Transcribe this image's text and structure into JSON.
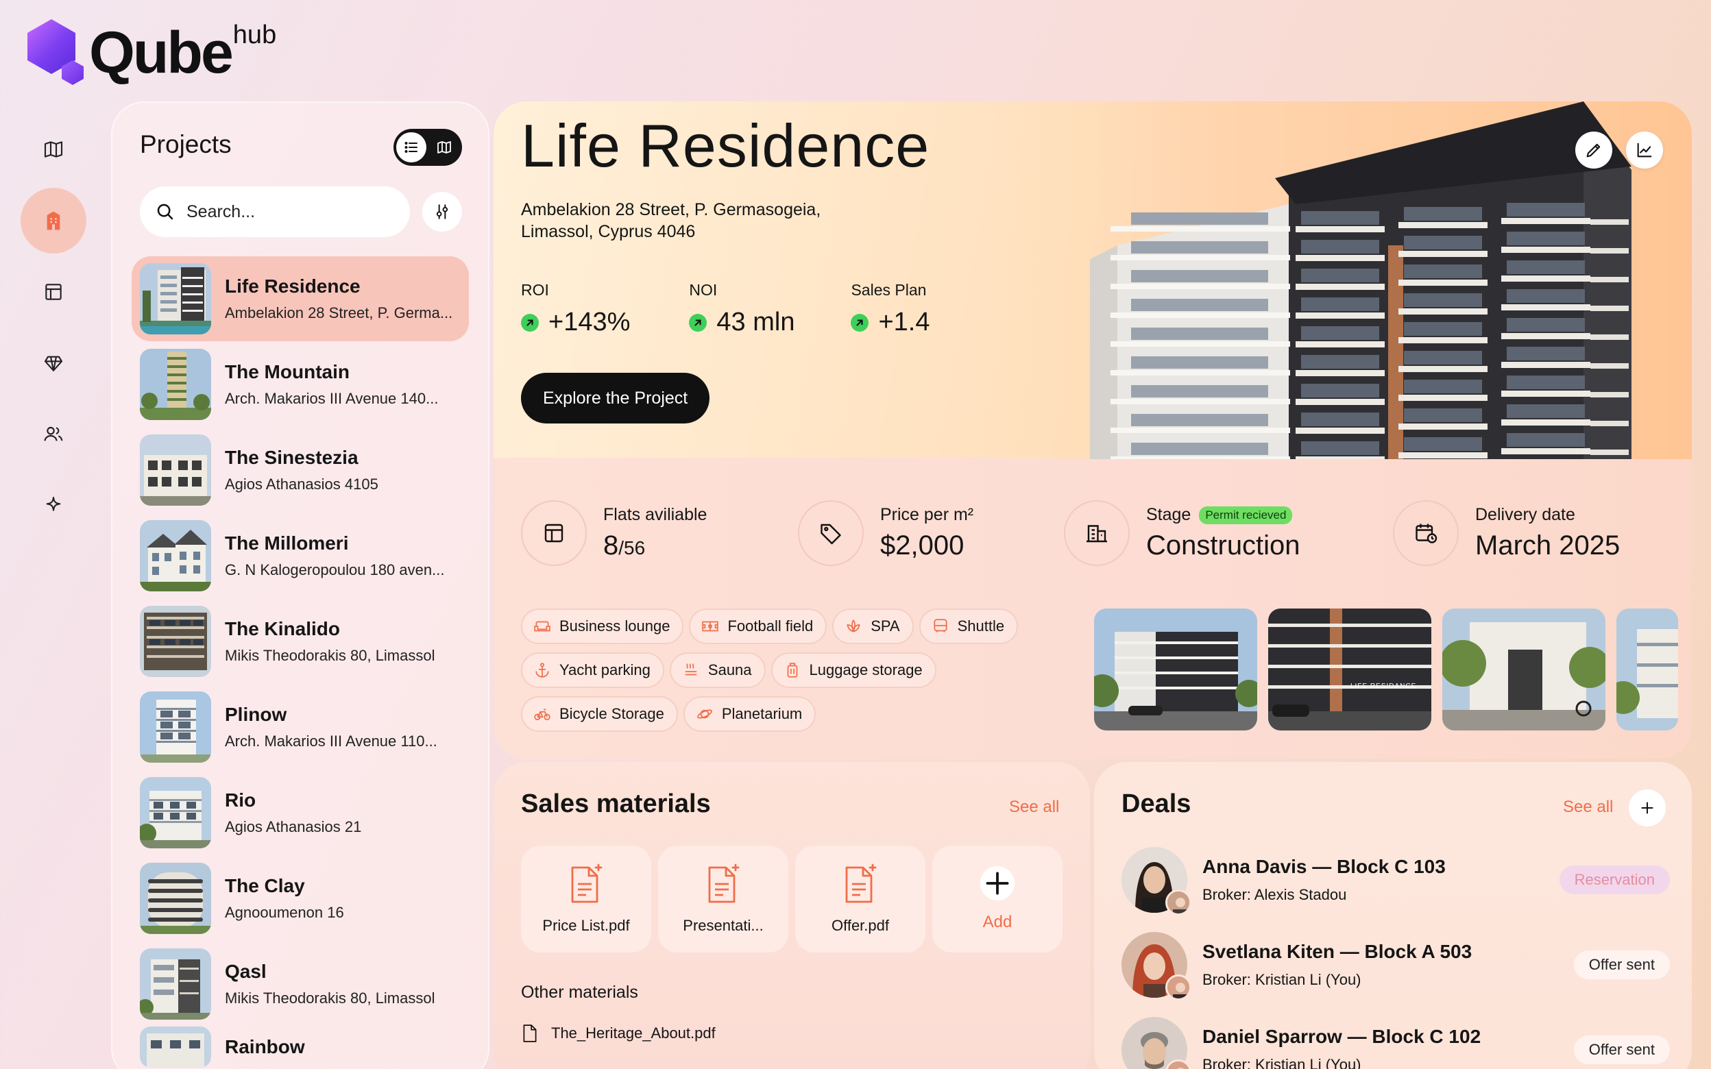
{
  "brand": {
    "name": "Qube",
    "sup": "hub"
  },
  "rail": [
    {
      "name": "map-icon"
    },
    {
      "name": "building-icon",
      "active": true
    },
    {
      "name": "layout-icon"
    },
    {
      "name": "diamond-icon"
    },
    {
      "name": "users-icon"
    },
    {
      "name": "sparkle-icon"
    }
  ],
  "projects": {
    "title": "Projects",
    "search_placeholder": "Search...",
    "items": [
      {
        "name": "Life Residence",
        "address": "Ambelakion 28 Street, P. Germa..."
      },
      {
        "name": "The Mountain",
        "address": "Arch. Makarios III Avenue 140..."
      },
      {
        "name": "The Sinestezia",
        "address": "Agios Athanasios 4105"
      },
      {
        "name": "The Millomeri",
        "address": "G. N Kalogeropoulou 180 aven..."
      },
      {
        "name": "The Kinalido",
        "address": "Mikis Theodorakis 80, Limassol"
      },
      {
        "name": "Plinow",
        "address": "Arch. Makarios III Avenue 110..."
      },
      {
        "name": "Rio",
        "address": "Agios Athanasios 21"
      },
      {
        "name": "The Clay",
        "address": "Agnooumenon 16"
      },
      {
        "name": "Qasl",
        "address": "Mikis Theodorakis 80, Limassol"
      },
      {
        "name": "Rainbow",
        "address": ""
      }
    ]
  },
  "hero": {
    "title": "Life Residence",
    "address_line1": "Ambelakion 28 Street, P. Germasogeia,",
    "address_line2": "Limassol, Cyprus 4046",
    "kpis": [
      {
        "label": "ROI",
        "value": "+143%"
      },
      {
        "label": "NOI",
        "value": "43 mln"
      },
      {
        "label": "Sales Plan",
        "value": "+1.4"
      }
    ],
    "cta": "Explore the Project"
  },
  "stats": {
    "flats_label": "Flats aviliable",
    "flats_value": "8",
    "flats_total": "/56",
    "price_label": "Price per m²",
    "price_value": "$2,000",
    "stage_label": "Stage",
    "stage_badge": "Permit recieved",
    "stage_value": "Construction",
    "delivery_label": "Delivery date",
    "delivery_value": "March 2025"
  },
  "amenities": [
    {
      "label": "Business lounge",
      "icon": "sofa-icon"
    },
    {
      "label": "Football field",
      "icon": "field-icon"
    },
    {
      "label": "SPA",
      "icon": "lotus-icon"
    },
    {
      "label": "Shuttle",
      "icon": "bus-icon"
    },
    {
      "label": "Yacht parking",
      "icon": "anchor-icon"
    },
    {
      "label": "Sauna",
      "icon": "steam-icon"
    },
    {
      "label": "Luggage storage",
      "icon": "luggage-icon"
    },
    {
      "label": "Bicycle Storage",
      "icon": "bicycle-icon"
    },
    {
      "label": "Planetarium",
      "icon": "planet-icon"
    }
  ],
  "gallery_caption": "LIFE RESIDANCE",
  "sales": {
    "title": "Sales materials",
    "see_all": "See all",
    "files": [
      "Price List.pdf",
      "Presentati...",
      "Offer.pdf"
    ],
    "add_label": "Add",
    "other_title": "Other materials",
    "other_files": [
      "The_Heritage_About.pdf"
    ]
  },
  "deals": {
    "title": "Deals",
    "see_all": "See all",
    "items": [
      {
        "name": "Anna Davis — Block C 103",
        "broker": "Broker: Alexis Stadou",
        "status": "Reservation",
        "kind": "res"
      },
      {
        "name": "Svetlana Kiten — Block A 503",
        "broker": "Broker: Kristian Li (You)",
        "status": "Offer sent",
        "kind": "sent"
      },
      {
        "name": "Daniel Sparrow — Block C 102",
        "broker": "Broker: Kristian Li (You)",
        "status": "Offer sent",
        "kind": "sent"
      }
    ]
  },
  "colors": {
    "accent": "#f06d4a",
    "active_bg": "#f8c5bb",
    "positive": "#3ecf5a",
    "dark": "#111111"
  }
}
